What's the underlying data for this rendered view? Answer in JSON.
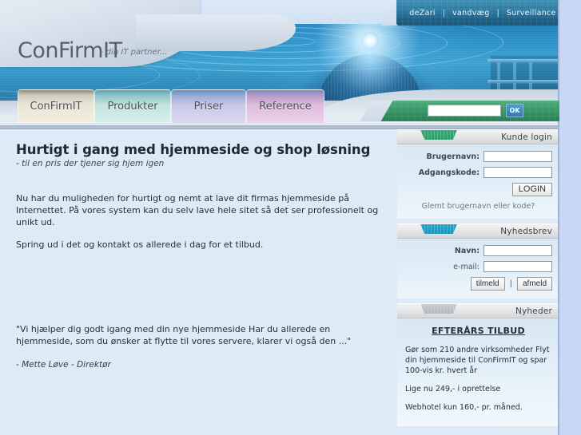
{
  "site": {
    "logo_text": "ConFirmIT",
    "logo_tagline": "- din IT partner...",
    "accent_green": "#2f9a68",
    "accent_blue": "#1f93b6",
    "body_bg": "#deeaf5",
    "page_bg": "#c8d8f4"
  },
  "topnav": {
    "items": [
      {
        "label": "deZari"
      },
      {
        "label": "vandvæg"
      },
      {
        "label": "Surveillance"
      }
    ],
    "separator": "|"
  },
  "tabs": [
    {
      "label": "ConFirmIT",
      "active": true
    },
    {
      "label": "Produkter",
      "active": false
    },
    {
      "label": "Priser",
      "active": false
    },
    {
      "label": "Reference",
      "active": false
    }
  ],
  "search": {
    "value": "",
    "placeholder": "",
    "button_label": "OK"
  },
  "main": {
    "title": "Hurtigt i gang med hjemmeside og shop løsning",
    "subtitle": "- til en pris der tjener sig hjem igen",
    "paragraph1": "Nu har du muligheden for hurtigt og nemt at lave dit firmas hjemmeside på Internettet. På vores system kan du selv lave hele sitet så det ser professionelt og unikt ud.",
    "paragraph2": "Spring ud i det og kontakt os allerede i dag for et tilbud.",
    "quote": "\"Vi hjælper dig godt igang med din nye hjemmeside Har du allerede en hjemmeside, som du ønsker at flytte til vores servere, klarer vi også den ...\"",
    "quote_author": "- Mette Løve - Direktør"
  },
  "sidebar": {
    "login_panel": {
      "title": "Kunde login",
      "username_label": "Brugernavn:",
      "username_value": "",
      "password_label": "Adgangskode:",
      "password_value": "",
      "login_button": "LOGIN",
      "forgot_link": "Glemt brugernavn eller kode?"
    },
    "newsletter_panel": {
      "title": "Nyhedsbrev",
      "name_label": "Navn:",
      "name_value": "",
      "email_label": "e-mail:",
      "email_value": "",
      "subscribe_button": "tilmeld",
      "separator": "|",
      "unsubscribe_button": "afmeld"
    },
    "news_panel": {
      "title": "Nyheder",
      "headline": "EFTERÅRS TILBUD",
      "body1": "Gør som 210 andre virksomheder Flyt din hjemmeside til ConFirmIT og spar 100-vis kr. hvert år",
      "body2": "Lige nu 249,- i oprettelse",
      "body3": "Webhotel kun 160,- pr. måned."
    }
  }
}
